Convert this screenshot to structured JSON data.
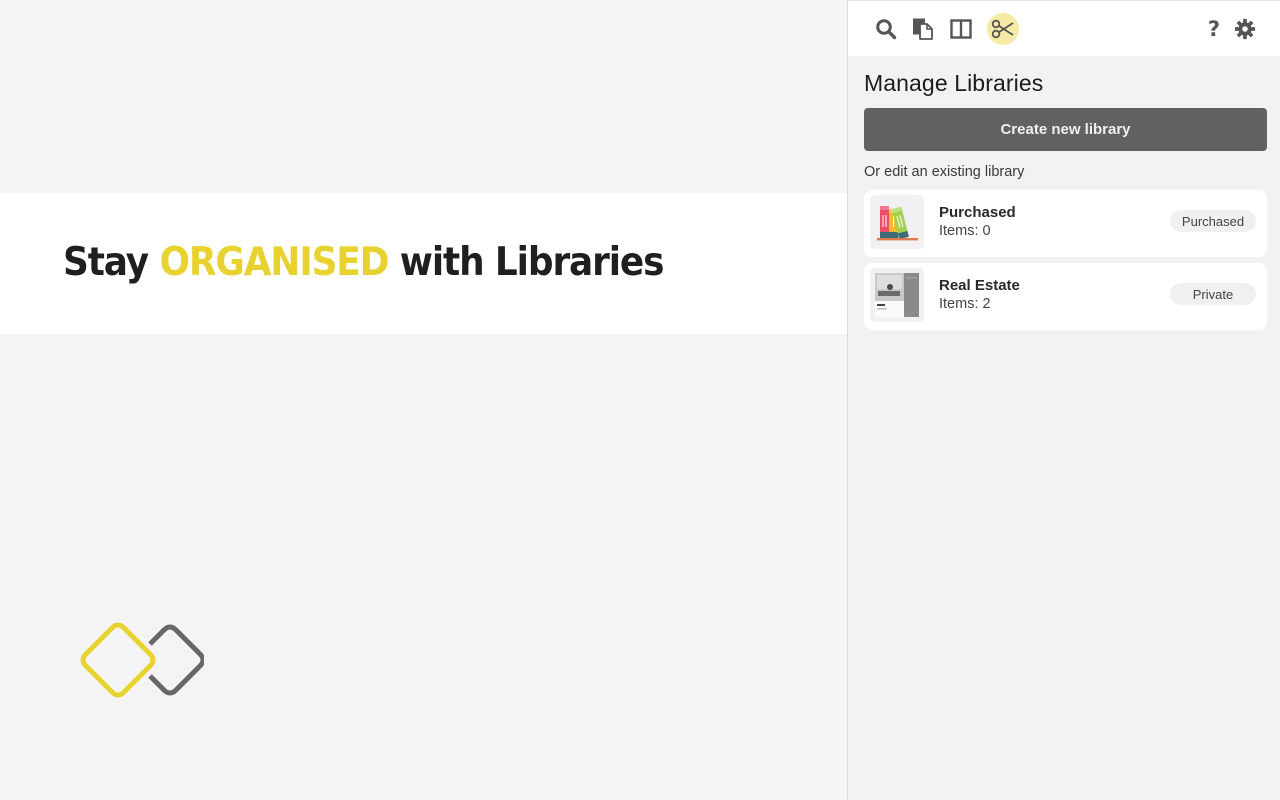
{
  "promo": {
    "title_prefix": "Stay ",
    "title_accent": "ORGANISED",
    "title_suffix": " with Libraries",
    "accent_color": "#e8d22f",
    "logo_icon": "linked-diamonds-logo"
  },
  "toolbar": {
    "left_tools": [
      {
        "name": "search",
        "icon": "search-icon"
      },
      {
        "name": "documents",
        "icon": "copy-documents-icon"
      },
      {
        "name": "split-view",
        "icon": "columns-icon"
      },
      {
        "name": "clip",
        "icon": "scissors-icon",
        "active": true
      }
    ],
    "right_tools": [
      {
        "name": "help",
        "icon": "help-icon",
        "label": "?"
      },
      {
        "name": "settings",
        "icon": "gear-icon"
      }
    ]
  },
  "panel": {
    "title": "Manage Libraries",
    "create_button": "Create new library",
    "subtitle": "Or edit an existing library",
    "libraries": [
      {
        "name": "Purchased",
        "count_text": "Items: 0",
        "badge": "Purchased",
        "thumb": "books-icon"
      },
      {
        "name": "Real Estate",
        "count_text": "Items: 2",
        "badge": "Private",
        "thumb": "real-estate-thumbnail"
      }
    ]
  }
}
